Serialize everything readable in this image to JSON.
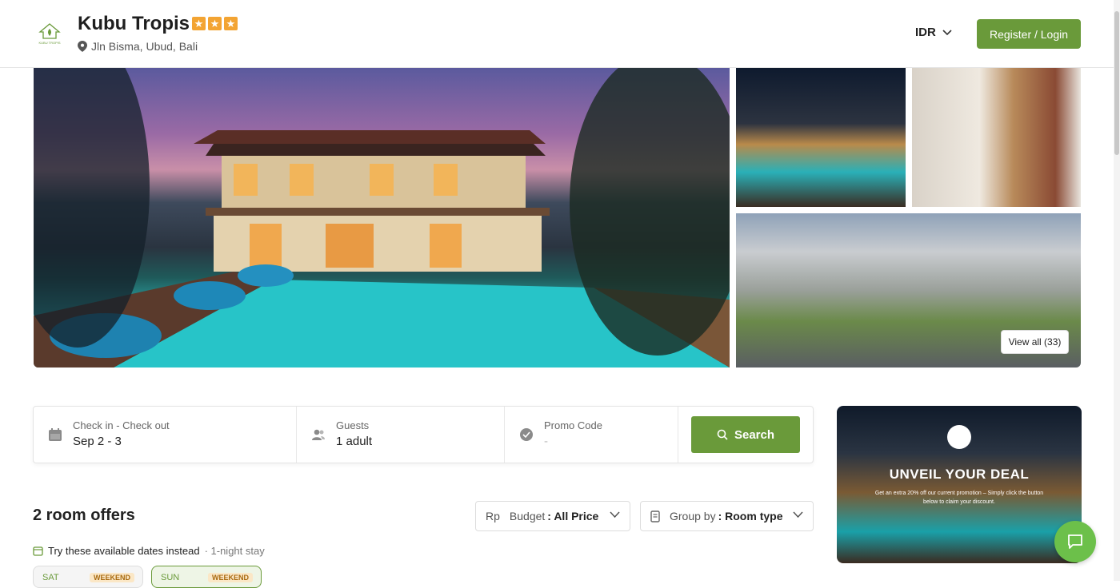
{
  "header": {
    "logo_text": "KUBU TROPIS",
    "hotel_name": "Kubu Tropis",
    "star_rating": 3,
    "address": "Jln Bisma, Ubud, Bali",
    "currency": "IDR",
    "login_label": "Register / Login"
  },
  "gallery": {
    "view_all_label": "View all (33)"
  },
  "search": {
    "dates_label": "Check in - Check out",
    "dates_value": "Sep 2 - 3",
    "guests_label": "Guests",
    "guests_value": "1 adult",
    "promo_label": "Promo Code",
    "promo_value": "-",
    "button_label": "Search"
  },
  "offers": {
    "title": "2 room offers",
    "budget_prefix": "Budget",
    "budget_currency": "Rp",
    "budget_value": ": All Price",
    "group_prefix": "Group by",
    "group_value": ": Room type",
    "available_text": "Try these available dates instead",
    "available_sub": "· 1-night stay",
    "date_chips": [
      {
        "day": "SAT",
        "tag": "WEEKEND"
      },
      {
        "day": "SUN",
        "tag": "WEEKEND"
      }
    ]
  },
  "promo": {
    "title": "UNVEIL YOUR DEAL",
    "text": "Get an extra 20% off our current promotion – Simply click the button below to claim your discount."
  },
  "colors": {
    "accent": "#6a9a3a",
    "star": "#f3a433",
    "chat": "#6cc04a"
  }
}
